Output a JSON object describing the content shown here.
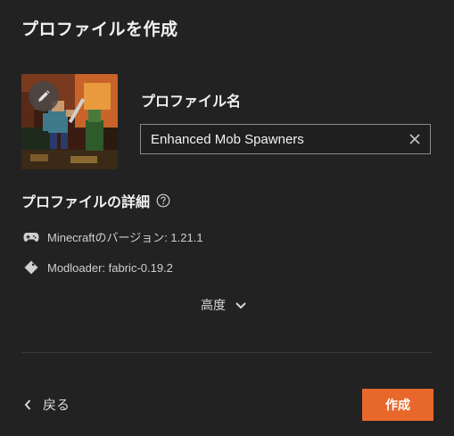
{
  "dialog": {
    "title": "プロファイルを作成"
  },
  "profile_name": {
    "label": "プロファイル名",
    "value": "Enhanced Mob Spawners"
  },
  "details": {
    "heading": "プロファイルの詳細",
    "minecraft_version": "Minecraftのバージョン: 1.21.1",
    "modloader": "Modloader: fabric-0.19.2"
  },
  "advanced": {
    "label": "高度"
  },
  "footer": {
    "back_label": "戻る",
    "create_label": "作成"
  },
  "colors": {
    "accent": "#e8682c",
    "background": "#222222"
  },
  "icons": [
    "edit-icon",
    "clear-icon",
    "help-icon",
    "gamepad-icon",
    "tag-icon",
    "chevron-down-icon",
    "chevron-left-icon"
  ]
}
